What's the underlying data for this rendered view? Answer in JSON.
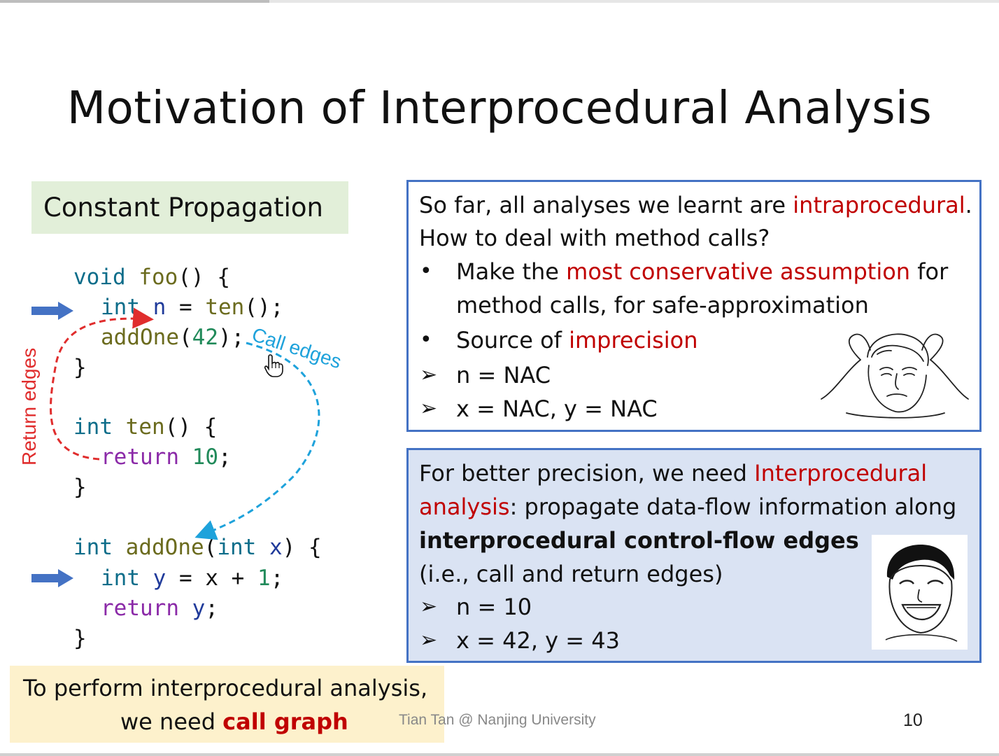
{
  "slide": {
    "title": "Motivation of Interprocedural Analysis",
    "section_label": "Constant Propagation",
    "code": {
      "foo_sig": [
        "void",
        "foo",
        "() {"
      ],
      "n_line": [
        "int",
        "n",
        " = ",
        "ten",
        "();"
      ],
      "addone_call": [
        "addOne",
        "(",
        "42",
        ");"
      ],
      "close": "}",
      "ten_sig": [
        "int",
        "ten",
        "() {"
      ],
      "ten_return": [
        "return",
        "10",
        ";"
      ],
      "addone_sig": [
        "int",
        "addOne",
        "(",
        "int",
        "x",
        ") {"
      ],
      "y_line": [
        "int",
        "y",
        " = ",
        "x",
        " + ",
        "1",
        ";"
      ],
      "y_return": [
        "return",
        "y",
        ";"
      ]
    },
    "edge_labels": {
      "return_edges": "Return edges",
      "call_edges": "Call edges"
    },
    "box1": {
      "line1": [
        "So far, all analyses we learnt are ",
        "intraprocedural",
        "."
      ],
      "line2": "How to deal with method calls?",
      "bullet1": [
        "Make the ",
        "most conservative assumption",
        " for"
      ],
      "bullet1_cont": "method calls, for safe-approximation",
      "bullet2": [
        "Source of ",
        "imprecision"
      ],
      "arrow1": "n = NAC",
      "arrow2": "x = NAC, y = NAC"
    },
    "box2": {
      "line1": [
        "For better precision, we need ",
        "Interprocedural"
      ],
      "line2": [
        "analysis",
        ": propagate data-flow information along"
      ],
      "line3": "interprocedural control-flow edges",
      "line4": "(i.e., call and return edges)",
      "arrow1": "n = 10",
      "arrow2": "x = 42, y = 43"
    },
    "bottom_note": {
      "line1": "To perform interprocedural analysis,",
      "line2_prefix": "we need ",
      "line2_highlight": "call graph"
    },
    "footer_author": "Tian Tan @ Nanjing University",
    "page_number": "10",
    "colors": {
      "accent_red": "#c00000",
      "box_border": "#4472c4",
      "box2_fill": "#dae3f3",
      "section_fill": "#e2efd9",
      "note_fill": "#fdf1cc",
      "return_edge": "#e02d2d",
      "call_edge": "#1ea2db",
      "arrow_blue": "#4472c4"
    },
    "icons": [
      "frustrated-face-icon",
      "laughing-face-icon",
      "hand-cursor-icon",
      "blue-arrow-icon"
    ]
  }
}
